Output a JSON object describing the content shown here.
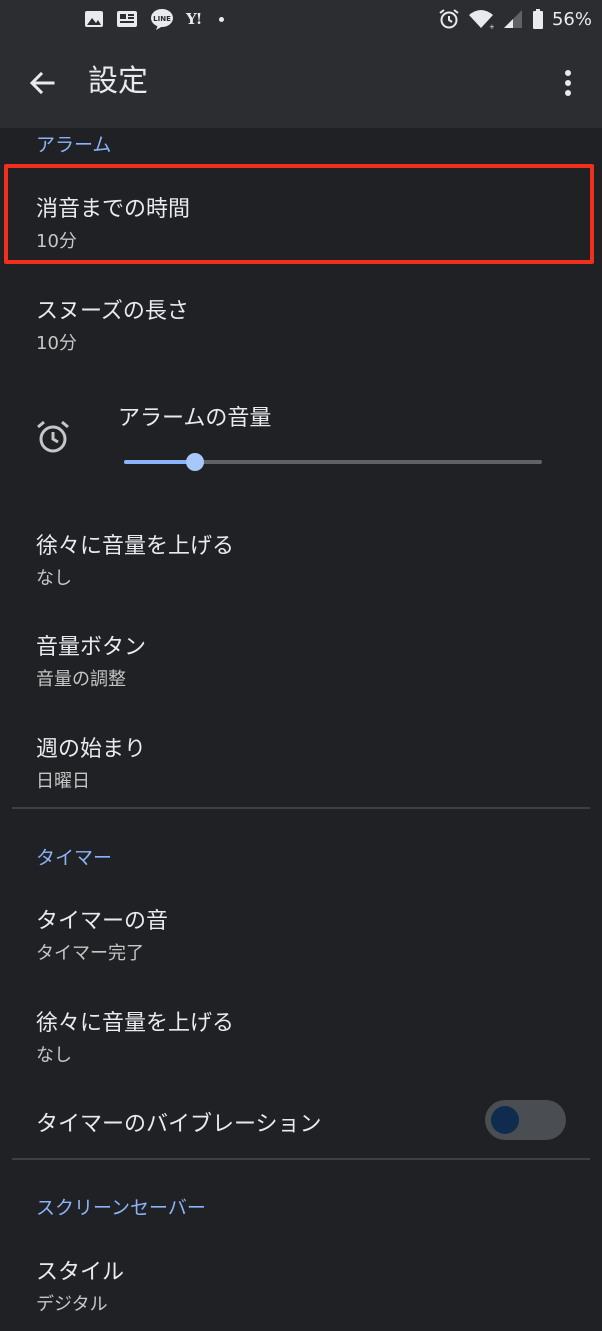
{
  "status_bar": {
    "yahoo_label": "Y!",
    "line_label": "LINE",
    "battery_text": "56%",
    "icons": [
      "gallery-icon",
      "news-icon",
      "line-icon",
      "yahoo-icon",
      "notification-dot",
      "alarm-icon",
      "wifi-icon",
      "signal-icon",
      "battery-icon"
    ]
  },
  "app_bar": {
    "title": "設定",
    "back_icon": "arrow-back-icon",
    "more_icon": "more-vert-icon"
  },
  "colors": {
    "background": "#202124",
    "bar": "#2b2d30",
    "accent": "#8ab4f8",
    "highlight": "#f0301c"
  },
  "sections": {
    "alarm": {
      "header": "アラーム",
      "silence_after": {
        "title": "消音までの時間",
        "summary": "10分"
      },
      "snooze_length": {
        "title": "スヌーズの長さ",
        "summary": "10分"
      },
      "alarm_volume": {
        "label": "アラームの音量",
        "level": 0.17
      },
      "gradually_increase": {
        "title": "徐々に音量を上げる",
        "summary": "なし"
      },
      "volume_buttons": {
        "title": "音量ボタン",
        "summary": "音量の調整"
      },
      "week_start": {
        "title": "週の始まり",
        "summary": "日曜日"
      }
    },
    "timer": {
      "header": "タイマー",
      "timer_sound": {
        "title": "タイマーの音",
        "summary": "タイマー完了"
      },
      "gradually_increase": {
        "title": "徐々に音量を上げる",
        "summary": "なし"
      },
      "vibration": {
        "title": "タイマーのバイブレーション",
        "enabled": false
      }
    },
    "screensaver": {
      "header": "スクリーンセーバー",
      "style": {
        "title": "スタイル",
        "summary": "デジタル"
      }
    }
  }
}
